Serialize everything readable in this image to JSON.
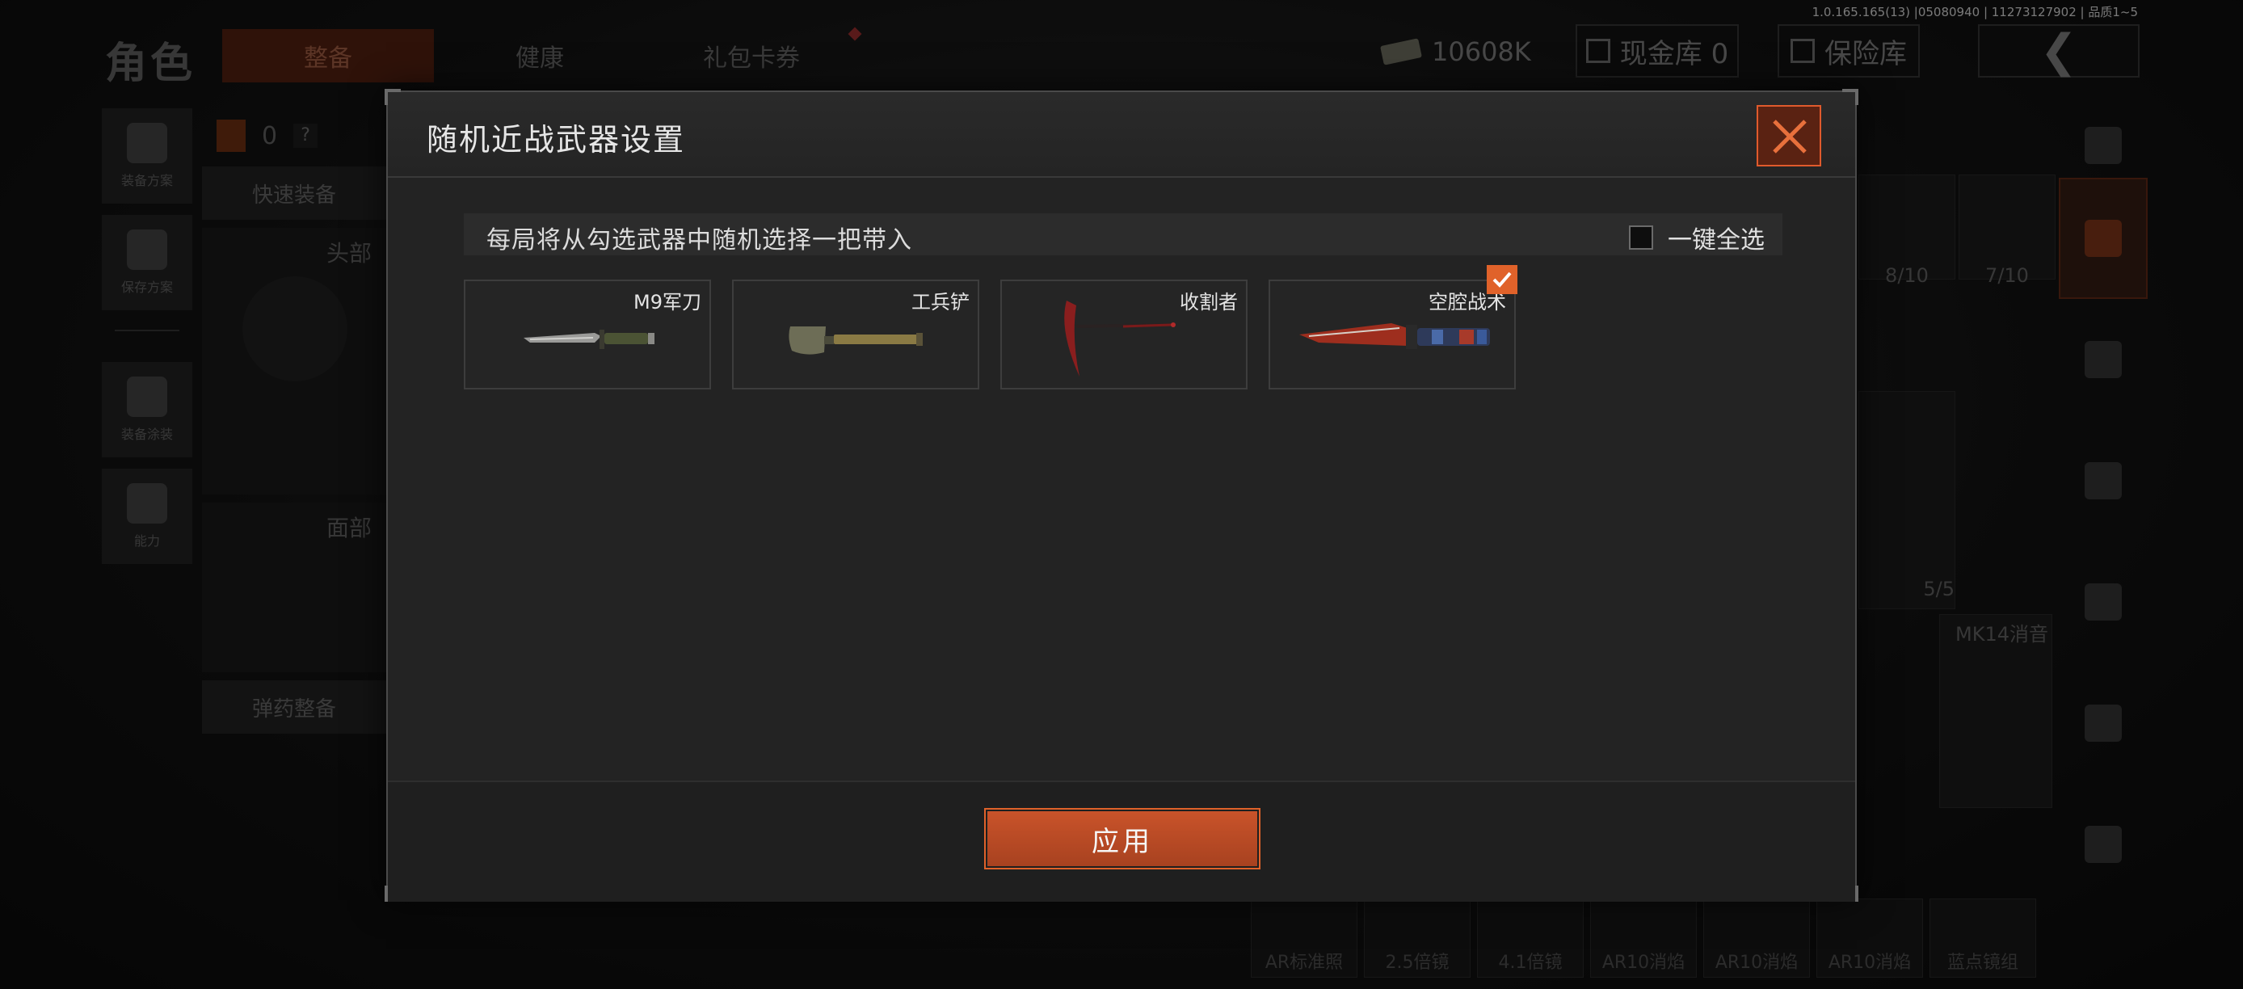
{
  "version": "1.0.165.165(13) |05080940 | 11273127902 | 品质1~5",
  "background": {
    "title": "角色",
    "nav_tabs": [
      "整备",
      "健康",
      "礼包卡券"
    ],
    "currency": "10608K",
    "cash_vault": "现金库 0",
    "safe_box": "保险库",
    "left_buttons": [
      "装备方案",
      "保存方案",
      "装备涂装",
      "能力"
    ],
    "loadout_count": "0",
    "help": "?",
    "quick_equip": "快速装备",
    "slot_head": "头部",
    "slot_face": "面部",
    "ammo_refill": "弹药整备",
    "right_tiles": [
      "8/10",
      "7/10",
      "5/5",
      "MK14消音"
    ],
    "bottom_items": [
      "AR标准照",
      "2.5倍镜",
      "4.1倍镜",
      "AR10消焰",
      "AR10消焰",
      "AR10消焰",
      "蓝点镜组"
    ]
  },
  "modal": {
    "title": "随机近战武器设置",
    "info": "每局将从勾选武器中随机选择一把带入",
    "select_all_label": "一键全选",
    "weapons": [
      {
        "name": "M9军刀",
        "checked": false
      },
      {
        "name": "工兵铲",
        "checked": false
      },
      {
        "name": "收割者",
        "checked": false
      },
      {
        "name": "空腔战术",
        "checked": true
      }
    ],
    "apply_label": "应用"
  },
  "colors": {
    "accent": "#e0622a",
    "accent_dark": "#5a2212",
    "panel": "#232323"
  }
}
